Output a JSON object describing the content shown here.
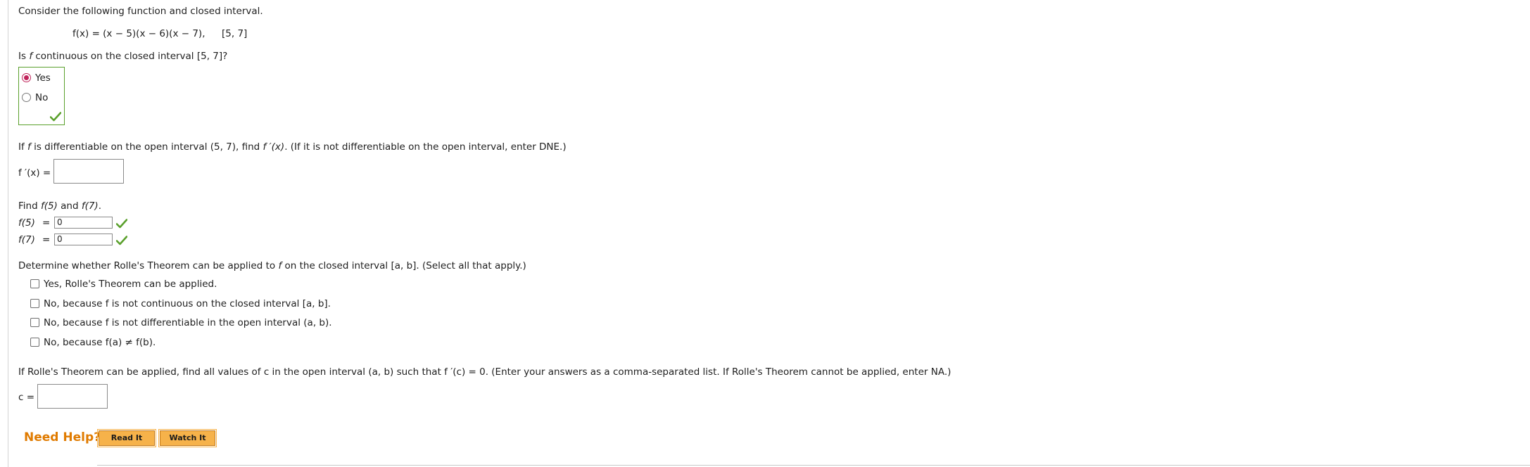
{
  "intro": "Consider the following function and closed interval.",
  "function_expr": "f(x) = (x − 5)(x − 6)(x − 7),",
  "interval": "[5, 7]",
  "q_continuous": {
    "pre": "Is ",
    "var": "f",
    "post": " continuous on the closed interval [5, 7]?",
    "options": [
      "Yes",
      "No"
    ],
    "selected": "Yes"
  },
  "q_derivative": {
    "pre": "If ",
    "var": "f",
    "mid": " is differentiable on the open interval (5, 7), find ",
    "fprime": "f ′(x)",
    "post": ". (If it is not differentiable on the open interval, enter DNE.)",
    "answer_label": "f ′(x) =",
    "answer_value": ""
  },
  "q_values": {
    "prompt_pre": "Find ",
    "f5": "f(5)",
    "and": " and ",
    "f7": "f(7)",
    "prompt_post": ".",
    "f5_label": "f(5)",
    "f7_label": "f(7)",
    "eq": "=",
    "f5_value": "0",
    "f7_value": "0"
  },
  "q_rolle": {
    "pre": "Determine whether Rolle's Theorem can be applied to ",
    "var": "f",
    "post": " on the closed interval [a, b]. (Select all that apply.)",
    "options": [
      "Yes, Rolle's Theorem can be applied.",
      "No, because f is not continuous on the closed interval [a, b].",
      "No, because f is not differentiable in the open interval (a, b).",
      "No, because f(a) ≠ f(b)."
    ]
  },
  "q_c": {
    "prompt": "If Rolle's Theorem can be applied, find all values of c in the open interval (a, b) such that f ′(c) = 0. (Enter your answers as a comma-separated list. If Rolle's Theorem cannot be applied, enter NA.)",
    "label": "c =",
    "value": ""
  },
  "help": {
    "title": "Need Help?",
    "read_it": "Read It",
    "watch_it": "Watch It"
  },
  "colors": {
    "correct_green": "#5aa02c",
    "radio_accent": "#c0235a",
    "help_orange": "#e07b00",
    "button_fill": "#f6b24a"
  }
}
